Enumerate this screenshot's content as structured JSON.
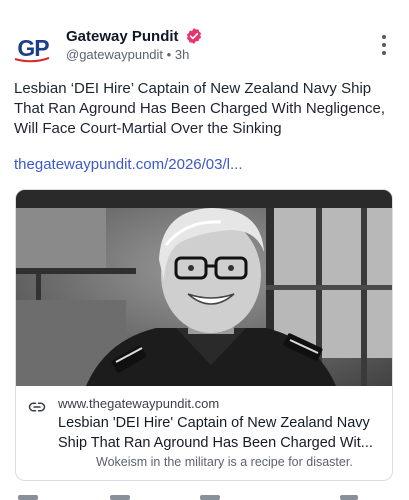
{
  "post": {
    "avatar_text": "GP",
    "author_name": "Gateway Pundit",
    "handle": "@gatewaypundit",
    "separator": "•",
    "time": "3h",
    "text": "Lesbian ‘DEI Hire’ Captain of New Zealand Navy Ship That Ran Aground Has Been Charged With Negligence, Will Face Court-Martial Over the Sinking",
    "link_text": "thegatewaypundit.com/2026/03/l..."
  },
  "card": {
    "domain": "www.thegatewaypundit.com",
    "title": "Lesbian 'DEI Hire' Captain of New Zealand Navy Ship That Ran Aground Has Been Charged Wit...",
    "description": "Wokeism in the military is a recipe for disaster."
  },
  "icons": {
    "verified": "verified-badge-icon",
    "more": "more-vertical-icon",
    "link": "link-icon"
  },
  "colors": {
    "link": "#3c59c9",
    "verified": "#e8336d",
    "brand": "#1b3e8a"
  }
}
